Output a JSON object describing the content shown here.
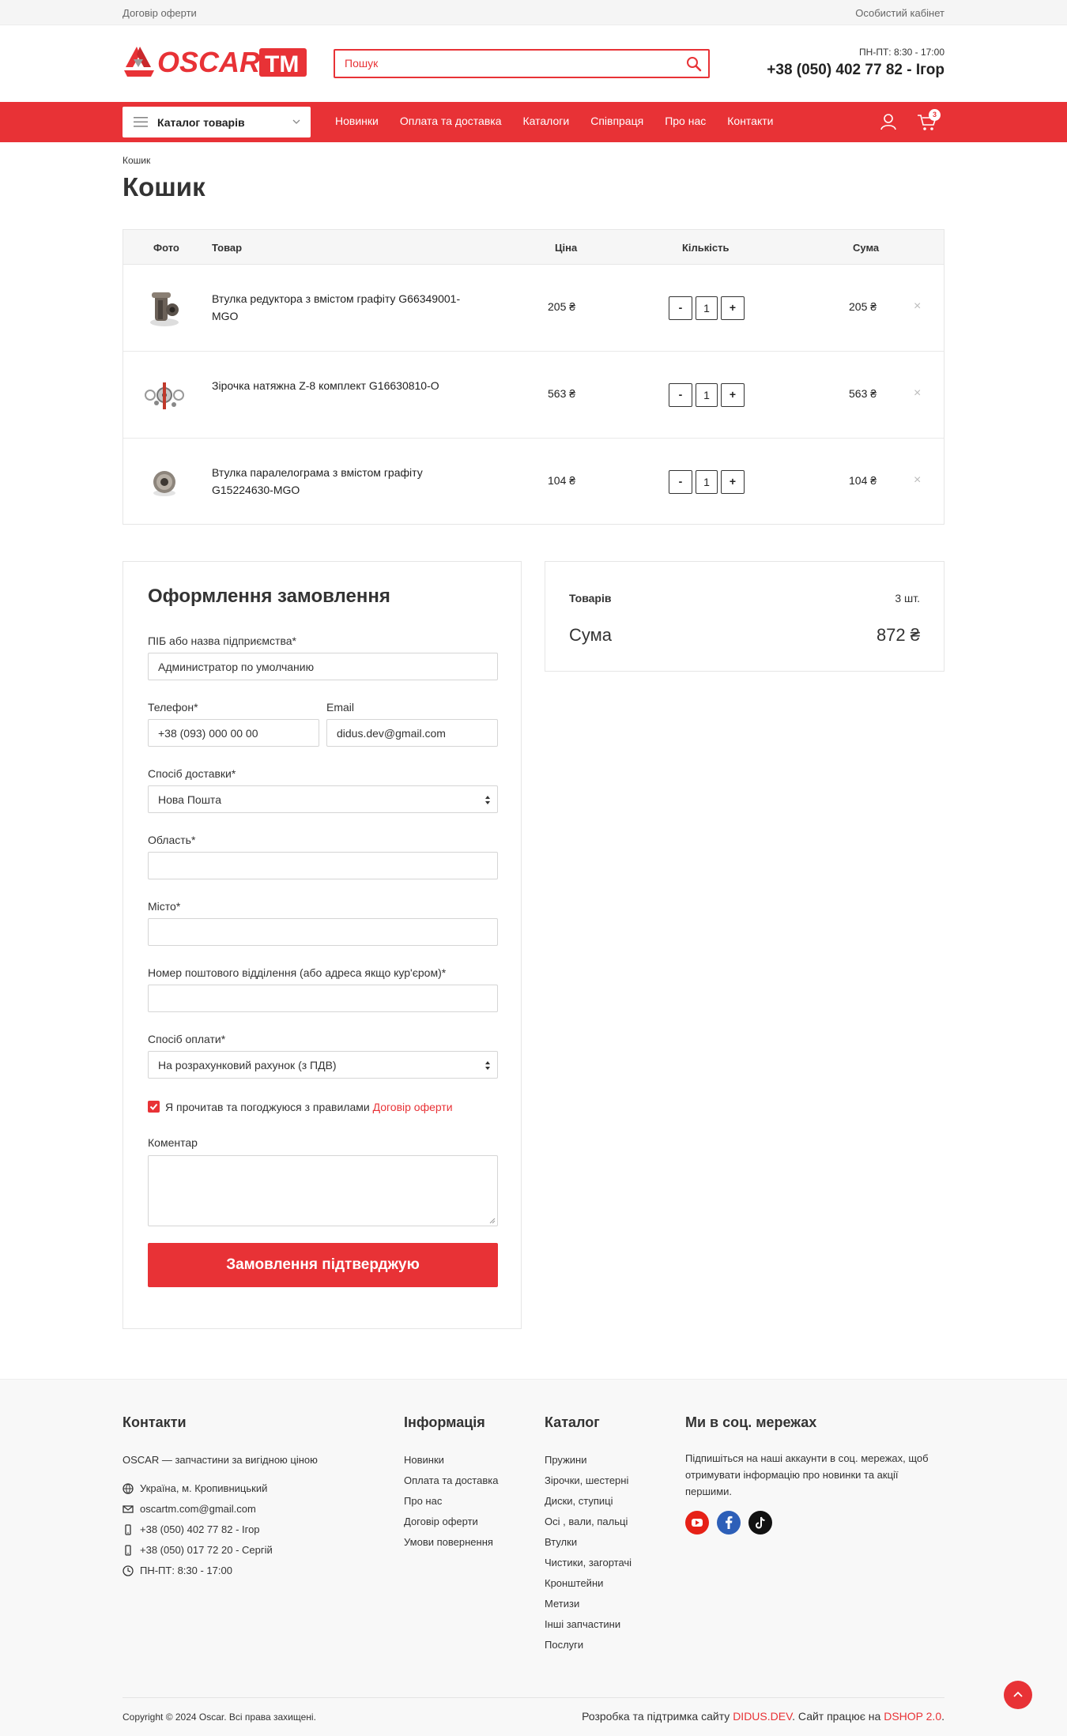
{
  "topbar": {
    "offer_link": "Договір оферти",
    "account_link": "Особистий кабінет"
  },
  "header": {
    "logo_text": "OSCAR",
    "logo_badge": "TM",
    "search_placeholder": "Пошук",
    "hours": "ПН-ПТ: 8:30 - 17:00",
    "phone": "+38 (050) 402 77 82 - Ігор"
  },
  "nav": {
    "catalog_label": "Каталог товарів",
    "links": [
      "Новинки",
      "Оплата та доставка",
      "Каталоги",
      "Співпраця",
      "Про нас",
      "Контакти"
    ],
    "cart_count": "3"
  },
  "breadcrumb": "Кошик",
  "page_title": "Кошик",
  "cart": {
    "headers": {
      "photo": "Фото",
      "product": "Товар",
      "price": "Ціна",
      "qty": "Кількість",
      "sum": "Сума"
    },
    "rows": [
      {
        "name": "Втулка редуктора з вмістом графіту G66349001-MGO",
        "price": "205 ₴",
        "qty": "1",
        "sum": "205 ₴",
        "minus": "-",
        "plus": "+",
        "remove": "×"
      },
      {
        "name": "Зірочка натяжна Z-8 комплект G16630810-O",
        "price": "563 ₴",
        "qty": "1",
        "sum": "563 ₴",
        "minus": "-",
        "plus": "+",
        "remove": "×"
      },
      {
        "name": "Втулка паралелограма з вмістом графіту G15224630-MGO",
        "price": "104 ₴",
        "qty": "1",
        "sum": "104 ₴",
        "minus": "-",
        "plus": "+",
        "remove": "×"
      }
    ]
  },
  "order": {
    "title": "Оформлення замовлення",
    "company_label": "ПІБ або назва підприємства*",
    "company_value": "Администратор по умолчанию",
    "phone_label": "Телефон*",
    "phone_value": "+38 (093) 000 00 00",
    "email_label": "Email",
    "email_value": "didus.dev@gmail.com",
    "delivery_label": "Спосіб доставки*",
    "delivery_value": "Нова Пошта",
    "region_label": "Область*",
    "city_label": "Місто*",
    "branch_label": "Номер поштового відділення (або адреса якщо кур'єром)*",
    "payment_label": "Спосіб оплати*",
    "payment_value": "На розрахунковий рахунок (з ПДВ)",
    "agree_text": "Я прочитав та погоджуюся з правилами",
    "agree_link": "Договір оферти",
    "comment_label": "Коментар",
    "submit": "Замовлення підтверджую"
  },
  "summary": {
    "items_label": "Товарів",
    "items_value": "3 шт.",
    "sum_label": "Сума",
    "sum_value": "872 ₴"
  },
  "footer": {
    "contacts_title": "Контакти",
    "tagline": "OSCAR — запчастини за вигідною ціною",
    "address": "Україна, м. Кропивницький",
    "email": "oscartm.com@gmail.com",
    "phone1": "+38 (050) 402 77 82 - Ігор",
    "phone2": "+38 (050) 017 72 20 - Сергій",
    "hours": "ПН-ПТ: 8:30 - 17:00",
    "info_title": "Інформація",
    "info_links": [
      "Новинки",
      "Оплата та доставка",
      "Про нас",
      "Договір оферти",
      "Умови повернення"
    ],
    "catalog_title": "Каталог",
    "catalog_links": [
      "Пружини",
      "Зірочки, шестерні",
      "Диски, ступиці",
      "Осі , вали, пальці",
      "Втулки",
      "Чистики, загортачі",
      "Кронштейни",
      "Метизи",
      "Інші запчастини",
      "Послуги"
    ],
    "social_title": "Ми в соц. мережах",
    "social_text": "Підпишіться на наші аккаунти в соц. мережах, щоб отримувати інформацію про новинки та акції першими.",
    "copyright": "Copyright © 2024 Oscar. Всі права захищені.",
    "dev_prefix": "Розробка та підтримка сайту",
    "dev_link": "DIDUS.DEV",
    "dev_mid": ". Сайт працює на",
    "dev_platform": "DSHOP 2.0",
    "dev_suffix": "."
  },
  "colors": {
    "accent": "#e83236",
    "text": "#222222",
    "border": "#e6e6e6"
  }
}
